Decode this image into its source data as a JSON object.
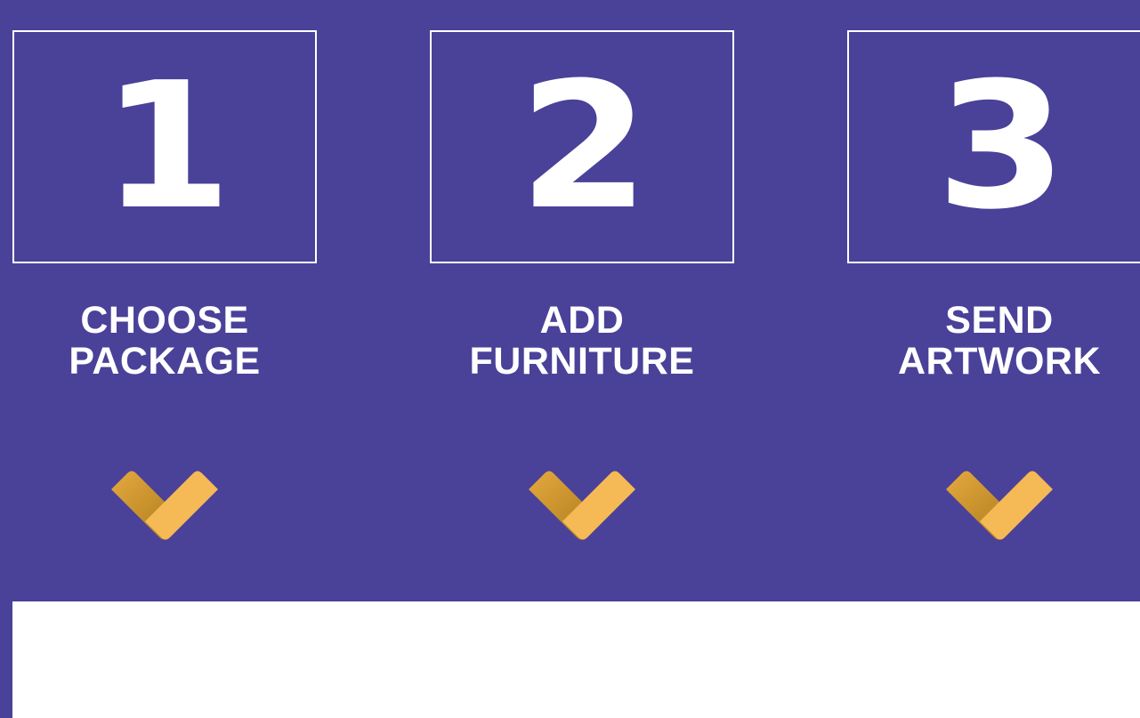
{
  "colors": {
    "background": "#4a4199",
    "box_border": "#ffffff",
    "text": "#ffffff",
    "chevron_light": "#f5b955",
    "chevron_dark": "#b88a22",
    "panel": "#ffffff"
  },
  "steps": [
    {
      "number": "1",
      "label_line1": "CHOOSE",
      "label_line2": "PACKAGE",
      "icon": "chevron-down-icon"
    },
    {
      "number": "2",
      "label_line1": "ADD",
      "label_line2": "FURNITURE",
      "icon": "chevron-down-icon"
    },
    {
      "number": "3",
      "label_line1": "SEND",
      "label_line2": "ARTWORK",
      "icon": "chevron-down-icon"
    }
  ]
}
